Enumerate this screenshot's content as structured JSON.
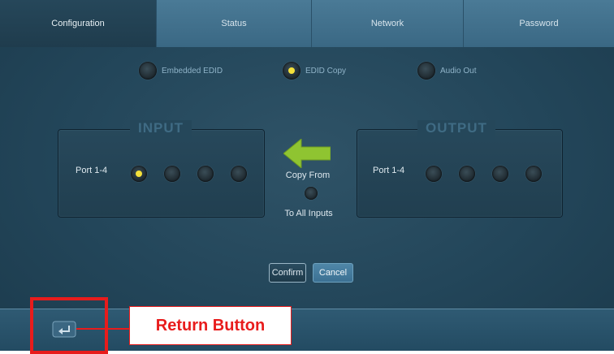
{
  "tabs": [
    {
      "label": "Configuration",
      "active": true
    },
    {
      "label": "Status",
      "active": false
    },
    {
      "label": "Network",
      "active": false
    },
    {
      "label": "Password",
      "active": false
    }
  ],
  "modes": [
    {
      "label": "Embedded EDID",
      "selected": false
    },
    {
      "label": "EDID Copy",
      "selected": true
    },
    {
      "label": "Audio Out",
      "selected": false
    }
  ],
  "input_panel": {
    "title": "INPUT",
    "port_label": "Port 1-4",
    "ports_selected": [
      true,
      false,
      false,
      false
    ]
  },
  "output_panel": {
    "title": "OUTPUT",
    "port_label": "Port 1-4",
    "ports_selected": [
      false,
      false,
      false,
      false
    ]
  },
  "copy": {
    "copy_from_label": "Copy From",
    "to_all_label": "To All Inputs",
    "arrow_icon": "left-arrow-icon",
    "arrow_color": "#8fc431"
  },
  "buttons": {
    "confirm_label": "Confirm",
    "cancel_label": "Cancel"
  },
  "bottom_bar": {
    "return_icon": "return-icon"
  },
  "annotation": {
    "callout_label": "Return Button",
    "color": "#e81c1c"
  },
  "colors": {
    "background": "#23465a",
    "tab_active": "#1f3c4d",
    "tab_inactive": "#4a7a96",
    "radio_selected": "#f4e03a"
  }
}
